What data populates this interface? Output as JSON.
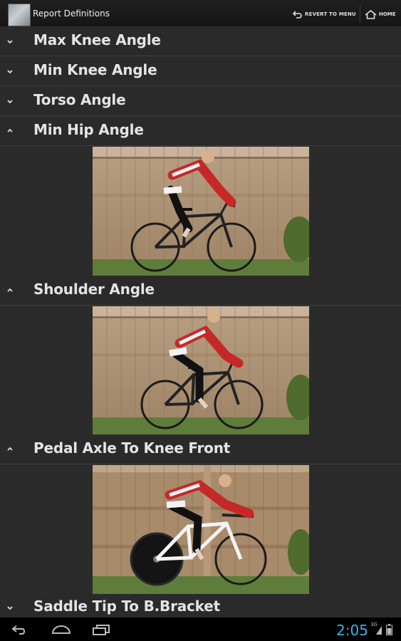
{
  "header": {
    "title": "Report Definitions",
    "revert_label": "REVERT TO MENU",
    "home_label": "HOME"
  },
  "rows": [
    {
      "label": "Max Knee Angle",
      "expanded": false
    },
    {
      "label": "Min Knee Angle",
      "expanded": false
    },
    {
      "label": "Torso Angle",
      "expanded": false
    },
    {
      "label": "Min Hip Angle",
      "expanded": true
    },
    {
      "label": "Shoulder Angle",
      "expanded": true
    },
    {
      "label": "Pedal Axle To Knee Front",
      "expanded": true
    },
    {
      "label": "Saddle Tip To B.Bracket",
      "expanded": false
    }
  ],
  "status": {
    "time": "2:05",
    "signal": "3G"
  },
  "colors": {
    "background": "#2b2b2b",
    "accent": "#33b5e5",
    "jersey_red": "#d32f2f"
  }
}
